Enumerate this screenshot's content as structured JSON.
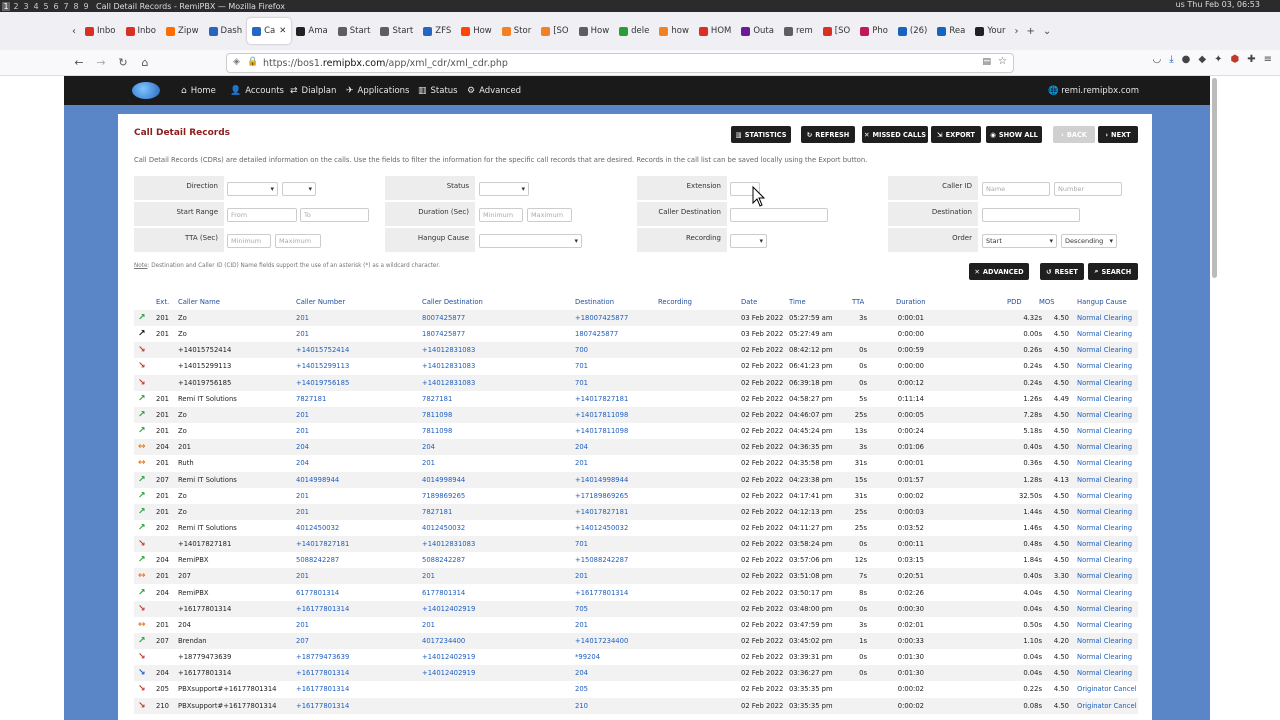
{
  "os": {
    "workspaces": [
      "1",
      "2",
      "3",
      "4",
      "5",
      "6",
      "7",
      "8",
      "9"
    ],
    "title": "Call Detail Records - RemiPBX — Mozilla Firefox",
    "tray_right": "us  Thu Feb 03, 06:53"
  },
  "browser": {
    "tabs": [
      {
        "label": "Inbo",
        "color": "#d93025"
      },
      {
        "label": "Inbo",
        "color": "#d93025"
      },
      {
        "label": "Zipw",
        "color": "#ff6d00"
      },
      {
        "label": "Dash",
        "color": "#2466c2"
      },
      {
        "label": "Ca",
        "color": "#2466c2",
        "active": true
      },
      {
        "label": "Ama",
        "color": "#222222"
      },
      {
        "label": "Start",
        "color": "#5e5e5e"
      },
      {
        "label": "Start",
        "color": "#5e5e5e"
      },
      {
        "label": "ZFS",
        "color": "#2466c2"
      },
      {
        "label": "How",
        "color": "#ff4500"
      },
      {
        "label": "Stor",
        "color": "#f48024"
      },
      {
        "label": "[SO",
        "color": "#f48024"
      },
      {
        "label": "How",
        "color": "#5e5e5e"
      },
      {
        "label": "dele",
        "color": "#2a9d3a"
      },
      {
        "label": "how",
        "color": "#f48024"
      },
      {
        "label": "HOM",
        "color": "#d93025"
      },
      {
        "label": "Outa",
        "color": "#6a1b9a"
      },
      {
        "label": "rem",
        "color": "#5e5e5e"
      },
      {
        "label": "[SO",
        "color": "#d93025"
      },
      {
        "label": "Pho",
        "color": "#c2185b"
      },
      {
        "label": "(26)",
        "color": "#1565c0"
      },
      {
        "label": "Rea",
        "color": "#1565c0"
      },
      {
        "label": "Your",
        "color": "#222222"
      }
    ],
    "url_prefix": "https://bos1.",
    "url_domain": "remipbx.com",
    "url_path": "/app/xml_cdr/xml_cdr.php"
  },
  "app": {
    "menu": [
      {
        "icon": "home-icon",
        "glyph": "⌂",
        "label": "Home"
      },
      {
        "icon": "user-icon",
        "glyph": "👤",
        "label": "Accounts"
      },
      {
        "icon": "dialplan-icon",
        "glyph": "⇄",
        "label": "Dialplan"
      },
      {
        "icon": "applications-icon",
        "glyph": "✈",
        "label": "Applications"
      },
      {
        "icon": "status-icon",
        "glyph": "▥",
        "label": "Status"
      },
      {
        "icon": "gear-icon",
        "glyph": "⚙",
        "label": "Advanced"
      }
    ],
    "domain": "remi.remipbx.com"
  },
  "page": {
    "title": "Call Detail Records",
    "description": "Call Detail Records (CDRs) are detailed information on the calls. Use the fields to filter the information for the specific call records that are desired. Records in the call list can be saved locally using the Export button.",
    "buttons": {
      "statistics": "Statistics",
      "refresh": "Refresh",
      "missed_calls": "Missed Calls",
      "export": "Export",
      "show_all": "Show All",
      "back": "Back",
      "next": "Next",
      "advanced": "Advanced",
      "reset": "Reset",
      "search": "Search"
    },
    "note_label": "Note",
    "note_text": ": Destination and Caller ID (CID) Name fields support the use of an asterisk (*) as a wildcard character."
  },
  "filters": {
    "direction": "Direction",
    "status": "Status",
    "extension": "Extension",
    "caller_id": "Caller ID",
    "caller_id_name_ph": "Name",
    "caller_id_number_ph": "Number",
    "start_range": "Start Range",
    "from_ph": "From",
    "to_ph": "To",
    "duration": "Duration (Sec)",
    "duration_min_ph": "Minimum",
    "duration_max_ph": "Maximum",
    "caller_destination": "Caller Destination",
    "destination": "Destination",
    "tta": "TTA (Sec)",
    "tta_min_ph": "Minimum",
    "tta_max_ph": "Maximum",
    "hangup_cause": "Hangup Cause",
    "recording": "Recording",
    "order": "Order",
    "order_by": "Start",
    "order_dir": "Descending"
  },
  "table": {
    "headers": [
      "Ext.",
      "Caller Name",
      "Caller Number",
      "Caller Destination",
      "Destination",
      "Recording",
      "Date",
      "Time",
      "TTA",
      "Duration",
      "PDD",
      "MOS",
      "Hangup Cause"
    ],
    "rows": [
      {
        "dir": "out",
        "ext": "201",
        "name": "Zo",
        "num": "201",
        "cdest": "8007425877",
        "dest": "+18007425877",
        "date": "03 Feb 2022",
        "time": "05:27:59 am",
        "tta": "3s",
        "dur": "0:00:01",
        "pdd": "4.32s",
        "mos": "4.50",
        "cause": "Normal Clearing"
      },
      {
        "dir": "blk",
        "ext": "201",
        "name": "Zo",
        "num": "201",
        "cdest": "1807425877",
        "dest": "1807425877",
        "date": "03 Feb 2022",
        "time": "05:27:49 am",
        "tta": "",
        "dur": "0:00:00",
        "pdd": "0.00s",
        "mos": "4.50",
        "cause": "Normal Clearing"
      },
      {
        "dir": "in",
        "ext": "",
        "name": "+14015752414",
        "num": "+14015752414",
        "cdest": "+14012831083",
        "dest": "700",
        "date": "02 Feb 2022",
        "time": "08:42:12 pm",
        "tta": "0s",
        "dur": "0:00:59",
        "pdd": "0.26s",
        "mos": "4.50",
        "cause": "Normal Clearing"
      },
      {
        "dir": "in",
        "ext": "",
        "name": "+14015299113",
        "num": "+14015299113",
        "cdest": "+14012831083",
        "dest": "701",
        "date": "02 Feb 2022",
        "time": "06:41:23 pm",
        "tta": "0s",
        "dur": "0:00:00",
        "pdd": "0.24s",
        "mos": "4.50",
        "cause": "Normal Clearing"
      },
      {
        "dir": "in",
        "ext": "",
        "name": "+14019756185",
        "num": "+14019756185",
        "cdest": "+14012831083",
        "dest": "701",
        "date": "02 Feb 2022",
        "time": "06:39:18 pm",
        "tta": "0s",
        "dur": "0:00:12",
        "pdd": "0.24s",
        "mos": "4.50",
        "cause": "Normal Clearing"
      },
      {
        "dir": "out",
        "ext": "201",
        "name": "Remi IT Solutions",
        "num": "7827181",
        "cdest": "7827181",
        "dest": "+14017827181",
        "date": "02 Feb 2022",
        "time": "04:58:27 pm",
        "tta": "5s",
        "dur": "0:11:14",
        "pdd": "1.26s",
        "mos": "4.49",
        "cause": "Normal Clearing"
      },
      {
        "dir": "out",
        "ext": "201",
        "name": "Zo",
        "num": "201",
        "cdest": "7811098",
        "dest": "+14017811098",
        "date": "02 Feb 2022",
        "time": "04:46:07 pm",
        "tta": "25s",
        "dur": "0:00:05",
        "pdd": "7.28s",
        "mos": "4.50",
        "cause": "Normal Clearing"
      },
      {
        "dir": "out",
        "ext": "201",
        "name": "Zo",
        "num": "201",
        "cdest": "7811098",
        "dest": "+14017811098",
        "date": "02 Feb 2022",
        "time": "04:45:24 pm",
        "tta": "13s",
        "dur": "0:00:24",
        "pdd": "5.18s",
        "mos": "4.50",
        "cause": "Normal Clearing"
      },
      {
        "dir": "loc",
        "ext": "204",
        "name": "201",
        "num": "204",
        "cdest": "204",
        "dest": "204",
        "date": "02 Feb 2022",
        "time": "04:36:35 pm",
        "tta": "3s",
        "dur": "0:01:06",
        "pdd": "0.40s",
        "mos": "4.50",
        "cause": "Normal Clearing"
      },
      {
        "dir": "loc",
        "ext": "201",
        "name": "Ruth",
        "num": "204",
        "cdest": "201",
        "dest": "201",
        "date": "02 Feb 2022",
        "time": "04:35:58 pm",
        "tta": "31s",
        "dur": "0:00:01",
        "pdd": "0.36s",
        "mos": "4.50",
        "cause": "Normal Clearing"
      },
      {
        "dir": "out",
        "ext": "207",
        "name": "Remi IT Solutions",
        "num": "4014998944",
        "cdest": "4014998944",
        "dest": "+14014998944",
        "date": "02 Feb 2022",
        "time": "04:23:38 pm",
        "tta": "15s",
        "dur": "0:01:57",
        "pdd": "1.28s",
        "mos": "4.13",
        "cause": "Normal Clearing"
      },
      {
        "dir": "out",
        "ext": "201",
        "name": "Zo",
        "num": "201",
        "cdest": "7189869265",
        "dest": "+17189869265",
        "date": "02 Feb 2022",
        "time": "04:17:41 pm",
        "tta": "31s",
        "dur": "0:00:02",
        "pdd": "32.50s",
        "mos": "4.50",
        "cause": "Normal Clearing"
      },
      {
        "dir": "out",
        "ext": "201",
        "name": "Zo",
        "num": "201",
        "cdest": "7827181",
        "dest": "+14017827181",
        "date": "02 Feb 2022",
        "time": "04:12:13 pm",
        "tta": "25s",
        "dur": "0:00:03",
        "pdd": "1.44s",
        "mos": "4.50",
        "cause": "Normal Clearing"
      },
      {
        "dir": "out",
        "ext": "202",
        "name": "Remi IT Solutions",
        "num": "4012450032",
        "cdest": "4012450032",
        "dest": "+14012450032",
        "date": "02 Feb 2022",
        "time": "04:11:27 pm",
        "tta": "25s",
        "dur": "0:03:52",
        "pdd": "1.46s",
        "mos": "4.50",
        "cause": "Normal Clearing"
      },
      {
        "dir": "in",
        "ext": "",
        "name": "+14017827181",
        "num": "+14017827181",
        "cdest": "+14012831083",
        "dest": "701",
        "date": "02 Feb 2022",
        "time": "03:58:24 pm",
        "tta": "0s",
        "dur": "0:00:11",
        "pdd": "0.48s",
        "mos": "4.50",
        "cause": "Normal Clearing"
      },
      {
        "dir": "out",
        "ext": "204",
        "name": "RemiPBX",
        "num": "5088242287",
        "cdest": "5088242287",
        "dest": "+15088242287",
        "date": "02 Feb 2022",
        "time": "03:57:06 pm",
        "tta": "12s",
        "dur": "0:03:15",
        "pdd": "1.84s",
        "mos": "4.50",
        "cause": "Normal Clearing"
      },
      {
        "dir": "loc",
        "ext": "201",
        "name": "207",
        "num": "201",
        "cdest": "201",
        "dest": "201",
        "date": "02 Feb 2022",
        "time": "03:51:08 pm",
        "tta": "7s",
        "dur": "0:20:51",
        "pdd": "0.40s",
        "mos": "3.30",
        "cause": "Normal Clearing"
      },
      {
        "dir": "out",
        "ext": "204",
        "name": "RemiPBX",
        "num": "6177801314",
        "cdest": "6177801314",
        "dest": "+16177801314",
        "date": "02 Feb 2022",
        "time": "03:50:17 pm",
        "tta": "8s",
        "dur": "0:02:26",
        "pdd": "4.04s",
        "mos": "4.50",
        "cause": "Normal Clearing"
      },
      {
        "dir": "in",
        "ext": "",
        "name": "+16177801314",
        "num": "+16177801314",
        "cdest": "+14012402919",
        "dest": "705",
        "date": "02 Feb 2022",
        "time": "03:48:00 pm",
        "tta": "0s",
        "dur": "0:00:30",
        "pdd": "0.04s",
        "mos": "4.50",
        "cause": "Normal Clearing"
      },
      {
        "dir": "loc",
        "ext": "201",
        "name": "204",
        "num": "201",
        "cdest": "201",
        "dest": "201",
        "date": "02 Feb 2022",
        "time": "03:47:59 pm",
        "tta": "3s",
        "dur": "0:02:01",
        "pdd": "0.50s",
        "mos": "4.50",
        "cause": "Normal Clearing"
      },
      {
        "dir": "out",
        "ext": "207",
        "name": "Brendan",
        "num": "207",
        "cdest": "4017234400",
        "dest": "+14017234400",
        "date": "02 Feb 2022",
        "time": "03:45:02 pm",
        "tta": "1s",
        "dur": "0:00:33",
        "pdd": "1.10s",
        "mos": "4.20",
        "cause": "Normal Clearing"
      },
      {
        "dir": "in",
        "ext": "",
        "name": "+18779473639",
        "num": "+18779473639",
        "cdest": "+14012402919",
        "dest": "*99204",
        "date": "02 Feb 2022",
        "time": "03:39:31 pm",
        "tta": "0s",
        "dur": "0:01:30",
        "pdd": "0.04s",
        "mos": "4.50",
        "cause": "Normal Clearing"
      },
      {
        "dir": "blu",
        "ext": "204",
        "name": "+16177801314",
        "num": "+16177801314",
        "cdest": "+14012402919",
        "dest": "204",
        "date": "02 Feb 2022",
        "time": "03:36:27 pm",
        "tta": "0s",
        "dur": "0:01:30",
        "pdd": "0.04s",
        "mos": "4.50",
        "cause": "Normal Clearing"
      },
      {
        "dir": "in",
        "ext": "205",
        "name": "PBXsupport#+16177801314",
        "num": "+16177801314",
        "cdest": "",
        "dest": "205",
        "date": "02 Feb 2022",
        "time": "03:35:35 pm",
        "tta": "",
        "dur": "0:00:02",
        "pdd": "0.22s",
        "mos": "4.50",
        "cause": "Originator Cancel"
      },
      {
        "dir": "in",
        "ext": "210",
        "name": "PBXsupport#+16177801314",
        "num": "+16177801314",
        "cdest": "",
        "dest": "210",
        "date": "02 Feb 2022",
        "time": "03:35:35 pm",
        "tta": "",
        "dur": "0:00:02",
        "pdd": "0.08s",
        "mos": "4.50",
        "cause": "Originator Cancel"
      }
    ]
  }
}
